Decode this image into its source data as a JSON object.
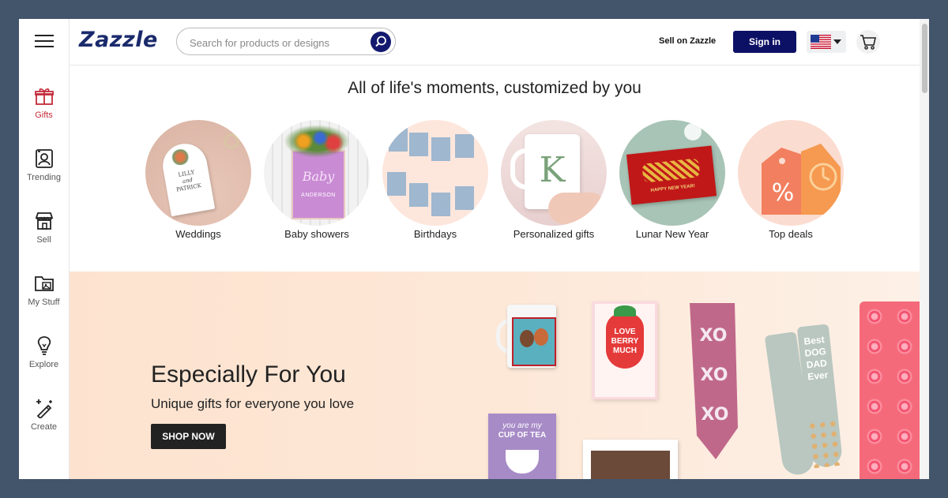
{
  "brand": {
    "logo": "Zazzle"
  },
  "sidebar": {
    "items": [
      {
        "label": "Gifts",
        "icon": "gift-icon"
      },
      {
        "label": "Trending",
        "icon": "trending-icon"
      },
      {
        "label": "Sell",
        "icon": "store-icon"
      },
      {
        "label": "My Stuff",
        "icon": "folder-icon"
      },
      {
        "label": "Explore",
        "icon": "lightbulb-icon"
      },
      {
        "label": "Create",
        "icon": "magic-wand-icon"
      }
    ]
  },
  "header": {
    "search_placeholder": "Search for products or designs",
    "sell_link": "Sell on Zazzle",
    "signin_label": "Sign in",
    "flag": "us-flag-icon",
    "cart": "cart-icon"
  },
  "categories": {
    "headline": "All of life's moments, customized by you",
    "items": [
      {
        "label": "Weddings"
      },
      {
        "label": "Baby showers"
      },
      {
        "label": "Birthdays"
      },
      {
        "label": "Personalized gifts"
      },
      {
        "label": "Lunar New Year"
      },
      {
        "label": "Top deals"
      }
    ]
  },
  "images": {
    "wedding_card": [
      "LILLY",
      "and",
      "PATRICK"
    ],
    "baby_sign": [
      "Baby",
      "ANDERSON"
    ],
    "mug_letter": "K",
    "lunar_card": "HAPPY NEW YEAR!"
  },
  "hero": {
    "title": "Especially For You",
    "subtitle": "Unique gifts for everyone you love",
    "cta": "SHOP NOW",
    "products": {
      "valentine_card": [
        "LOVE",
        "BERRY",
        "MUCH"
      ],
      "tea_card": [
        "you are my",
        "CUP OF TEA"
      ],
      "tie_text": "XOXO",
      "socks_text": [
        "Best",
        "DOG",
        "DAD",
        "Ever"
      ]
    }
  },
  "colors": {
    "accent_red": "#c32b3a",
    "navy": "#0d1165",
    "hero_bg": "#fde3cf"
  }
}
